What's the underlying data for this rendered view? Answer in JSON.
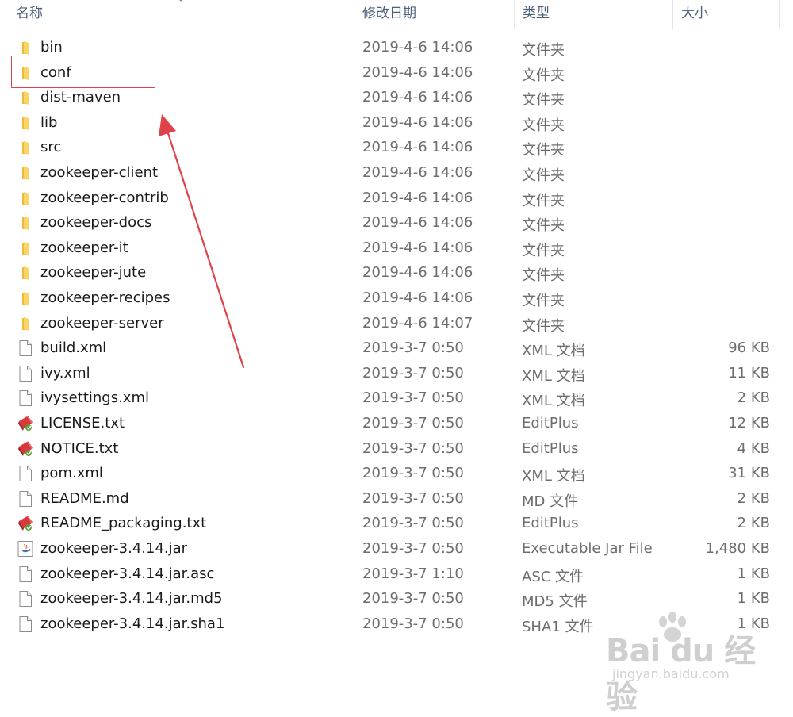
{
  "columns": {
    "name": "名称",
    "date": "修改日期",
    "type": "类型",
    "size": "大小"
  },
  "files": [
    {
      "name": "bin",
      "date": "2019-4-6 14:06",
      "type": "文件夹",
      "size": "",
      "icon": "folder-icon"
    },
    {
      "name": "conf",
      "date": "2019-4-6 14:06",
      "type": "文件夹",
      "size": "",
      "icon": "folder-icon"
    },
    {
      "name": "dist-maven",
      "date": "2019-4-6 14:06",
      "type": "文件夹",
      "size": "",
      "icon": "folder-icon"
    },
    {
      "name": "lib",
      "date": "2019-4-6 14:06",
      "type": "文件夹",
      "size": "",
      "icon": "folder-icon"
    },
    {
      "name": "src",
      "date": "2019-4-6 14:06",
      "type": "文件夹",
      "size": "",
      "icon": "folder-icon"
    },
    {
      "name": "zookeeper-client",
      "date": "2019-4-6 14:06",
      "type": "文件夹",
      "size": "",
      "icon": "folder-icon"
    },
    {
      "name": "zookeeper-contrib",
      "date": "2019-4-6 14:06",
      "type": "文件夹",
      "size": "",
      "icon": "folder-icon"
    },
    {
      "name": "zookeeper-docs",
      "date": "2019-4-6 14:06",
      "type": "文件夹",
      "size": "",
      "icon": "folder-icon"
    },
    {
      "name": "zookeeper-it",
      "date": "2019-4-6 14:06",
      "type": "文件夹",
      "size": "",
      "icon": "folder-icon"
    },
    {
      "name": "zookeeper-jute",
      "date": "2019-4-6 14:06",
      "type": "文件夹",
      "size": "",
      "icon": "folder-icon"
    },
    {
      "name": "zookeeper-recipes",
      "date": "2019-4-6 14:06",
      "type": "文件夹",
      "size": "",
      "icon": "folder-icon"
    },
    {
      "name": "zookeeper-server",
      "date": "2019-4-6 14:07",
      "type": "文件夹",
      "size": "",
      "icon": "folder-icon"
    },
    {
      "name": "build.xml",
      "date": "2019-3-7 0:50",
      "type": "XML 文档",
      "size": "96 KB",
      "icon": "document-icon"
    },
    {
      "name": "ivy.xml",
      "date": "2019-3-7 0:50",
      "type": "XML 文档",
      "size": "11 KB",
      "icon": "document-icon"
    },
    {
      "name": "ivysettings.xml",
      "date": "2019-3-7 0:50",
      "type": "XML 文档",
      "size": "2 KB",
      "icon": "document-icon"
    },
    {
      "name": "LICENSE.txt",
      "date": "2019-3-7 0:50",
      "type": "EditPlus",
      "size": "12 KB",
      "icon": "editplus-icon"
    },
    {
      "name": "NOTICE.txt",
      "date": "2019-3-7 0:50",
      "type": "EditPlus",
      "size": "4 KB",
      "icon": "editplus-icon"
    },
    {
      "name": "pom.xml",
      "date": "2019-3-7 0:50",
      "type": "XML 文档",
      "size": "31 KB",
      "icon": "document-icon"
    },
    {
      "name": "README.md",
      "date": "2019-3-7 0:50",
      "type": "MD 文件",
      "size": "2 KB",
      "icon": "document-icon"
    },
    {
      "name": "README_packaging.txt",
      "date": "2019-3-7 0:50",
      "type": "EditPlus",
      "size": "2 KB",
      "icon": "editplus-icon"
    },
    {
      "name": "zookeeper-3.4.14.jar",
      "date": "2019-3-7 0:50",
      "type": "Executable Jar File",
      "size": "1,480 KB",
      "icon": "java-jar-icon"
    },
    {
      "name": "zookeeper-3.4.14.jar.asc",
      "date": "2019-3-7 1:10",
      "type": "ASC 文件",
      "size": "1 KB",
      "icon": "document-icon"
    },
    {
      "name": "zookeeper-3.4.14.jar.md5",
      "date": "2019-3-7 0:50",
      "type": "MD5 文件",
      "size": "1 KB",
      "icon": "document-icon"
    },
    {
      "name": "zookeeper-3.4.14.jar.sha1",
      "date": "2019-3-7 0:50",
      "type": "SHA1 文件",
      "size": "1 KB",
      "icon": "document-icon"
    }
  ],
  "watermark": {
    "logo": "Bai du 经验",
    "site": "jingyan.baidu.com"
  },
  "colors": {
    "folder": "#f5c84c",
    "annotation": "#e0424a",
    "header_text": "#4c607a",
    "secondary_text": "#6d6d6d"
  }
}
